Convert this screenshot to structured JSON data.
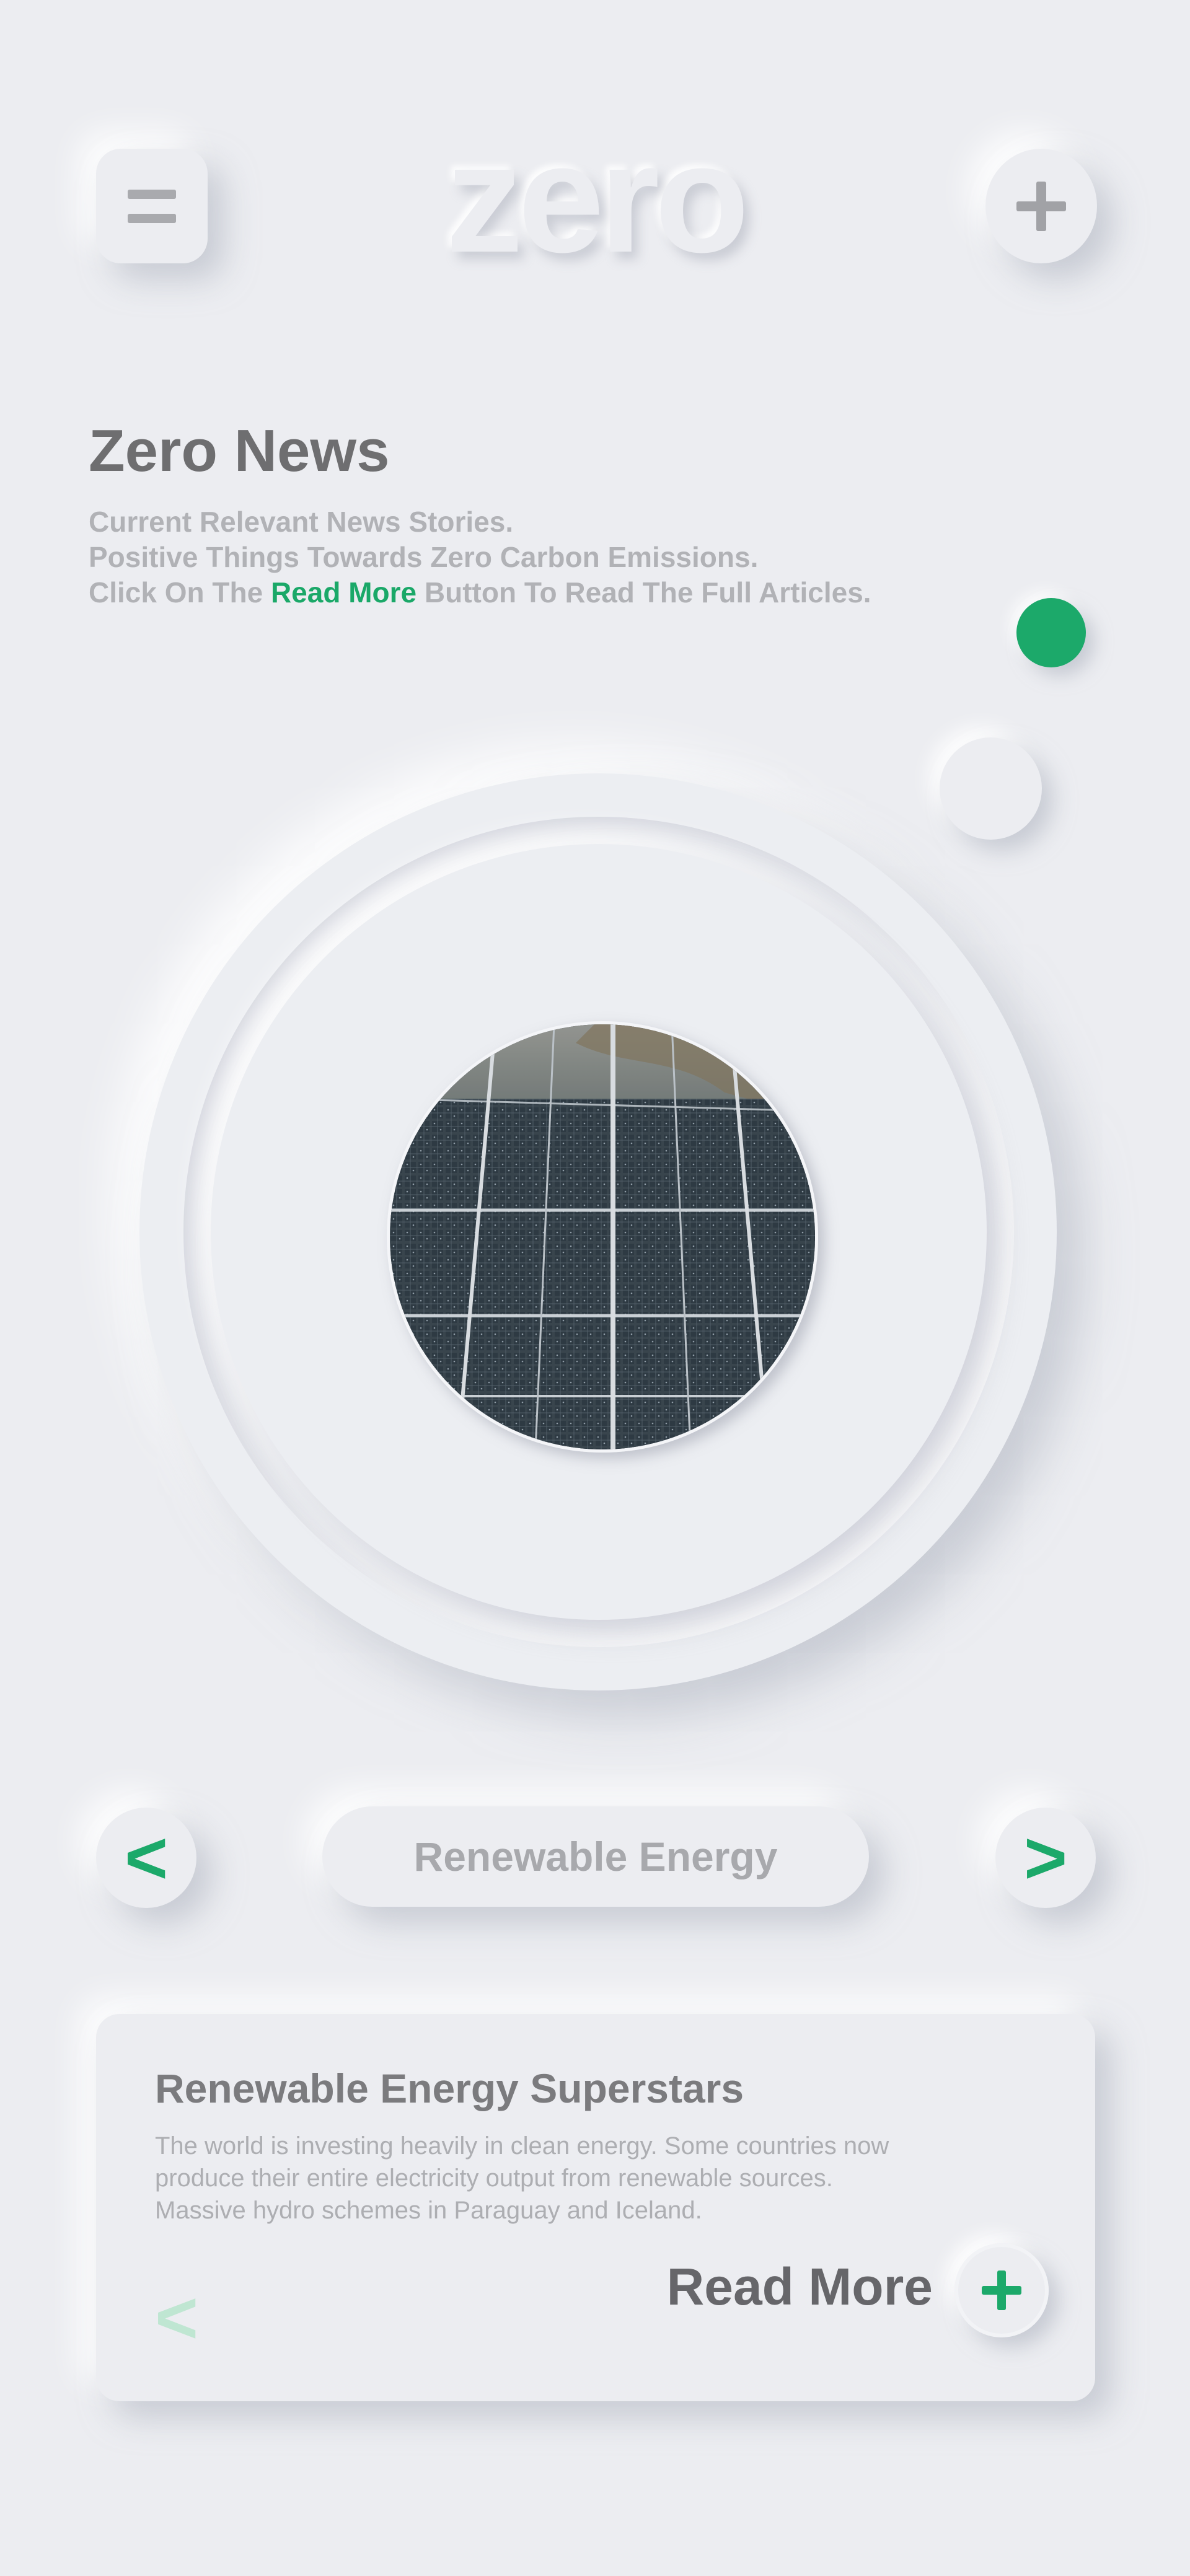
{
  "header": {
    "logo_text": "zero",
    "menu_icon": "hamburger-icon",
    "add_icon": "plus-icon"
  },
  "intro": {
    "title": "Zero News",
    "line1": "Current Relevant News Stories.",
    "line2": "Positive Things Towards Zero Carbon Emissions.",
    "line3_prefix": "Click On The ",
    "line3_highlight": "Read More",
    "line3_suffix": " Button To Read The Full Articles."
  },
  "slider": {
    "active_index": 0,
    "count": 2,
    "image_alt": "solar panels"
  },
  "category": {
    "prev_label": "<",
    "next_label": ">",
    "current": "Renewable Energy"
  },
  "article": {
    "title": "Renewable Energy Superstars",
    "body_line1": "The world is investing heavily in clean energy. Some countries now",
    "body_line2": "produce their entire electricity output from renewable sources.",
    "body_line3": "Massive hydro schemes in Paraguay and Iceland.",
    "read_more_label": "Read More",
    "back_label": "<"
  },
  "colors": {
    "background": "#ecedf1",
    "accent": "#1ca96a",
    "text_dark": "#6e6e70",
    "text_muted": "#b1b2b6"
  }
}
